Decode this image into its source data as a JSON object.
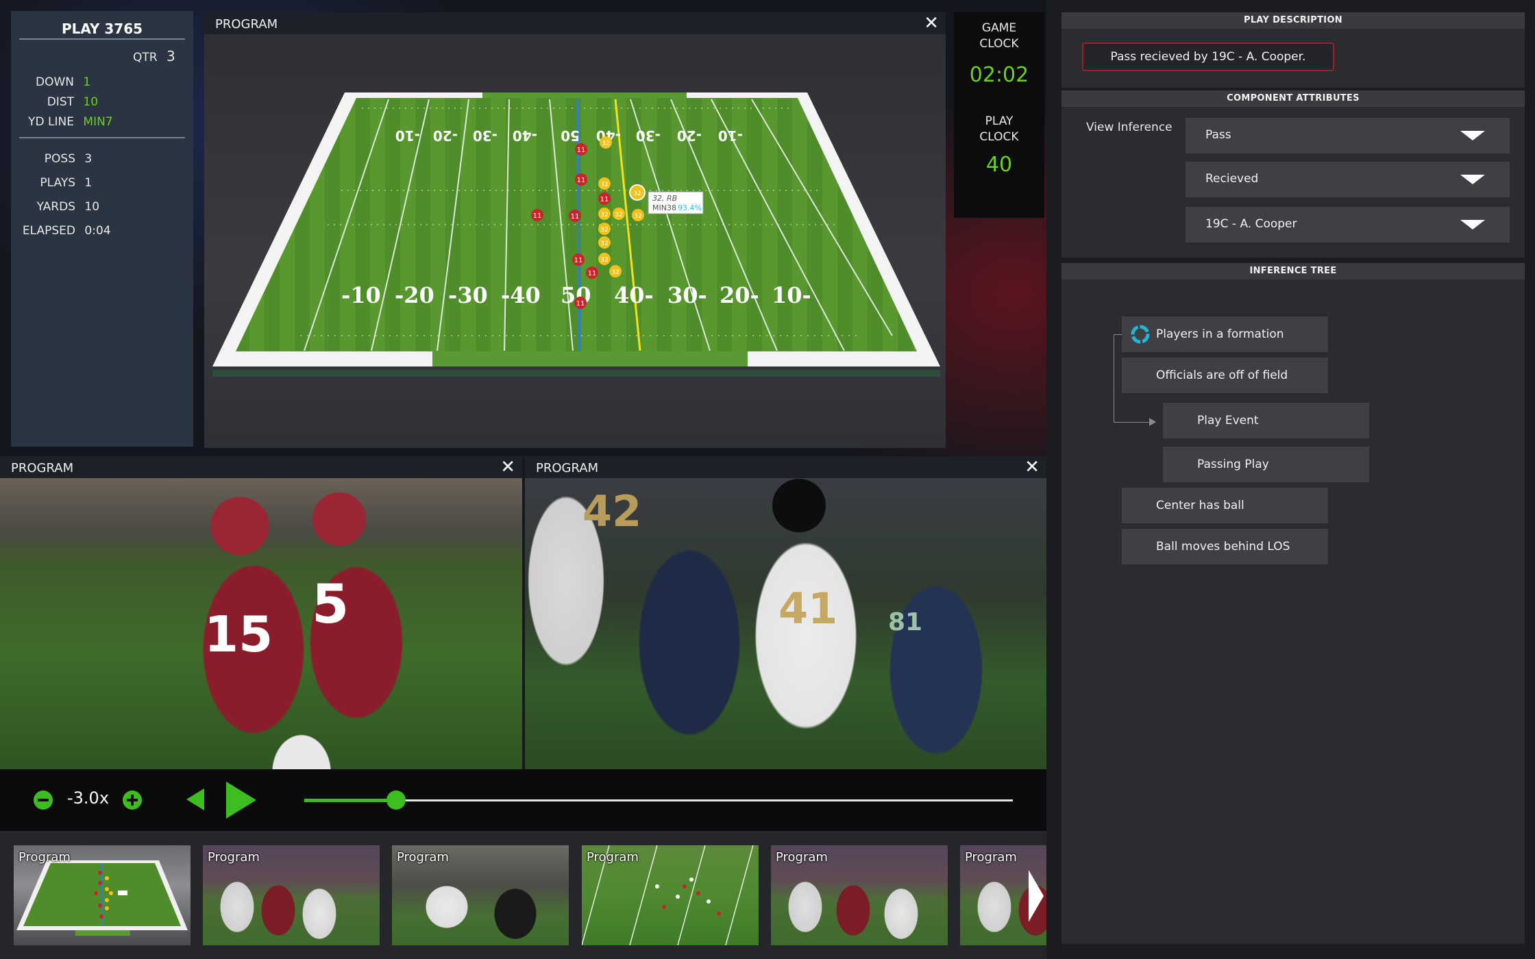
{
  "stats": {
    "play_title": "PLAY 3765",
    "qtr_label": "QTR",
    "qtr_value": "3",
    "down_label": "DOWN",
    "down_value": "1",
    "dist_label": "DIST",
    "dist_value": "10",
    "ydline_label": "YD LINE",
    "ydline_value": "MIN7",
    "poss_label": "POSS",
    "poss_value": "3",
    "plays_label": "PLAYS",
    "plays_value": "1",
    "yards_label": "YARDS",
    "yards_value": "10",
    "elapsed_label": "ELAPSED",
    "elapsed_value": "0:04"
  },
  "program_top": {
    "title": "PROGRAM",
    "close": "✕",
    "field_numbers_far": [
      "-10",
      "-20",
      "-30",
      "-40",
      "50",
      "-40",
      "-30",
      "-20",
      "-10"
    ],
    "field_numbers_near": [
      "-10",
      "-20",
      "-30",
      "-40",
      "50",
      "40-",
      "30-",
      "20-",
      "10-"
    ],
    "tooltip": {
      "line1": "32, RB",
      "line2_prefix": "MIN38",
      "line2_pct": "93.4%"
    },
    "players_red": [
      "11",
      "11",
      "11",
      "11",
      "11",
      "11",
      "11",
      "11"
    ],
    "players_yellow": [
      "32",
      "32",
      "32",
      "32",
      "32",
      "32",
      "32",
      "32",
      "32",
      "32"
    ]
  },
  "clocks": {
    "game_label_1": "GAME",
    "game_label_2": "CLOCK",
    "game_value": "02:02",
    "play_label_1": "PLAY",
    "play_label_2": "CLOCK",
    "play_value": "40"
  },
  "program_left": {
    "title": "PROGRAM",
    "close": "✕",
    "jersey_a": "15",
    "jersey_b": "5"
  },
  "program_right": {
    "title": "PROGRAM",
    "close": "✕",
    "jersey_a": "42",
    "jersey_b": "41",
    "jersey_c": "81"
  },
  "controls": {
    "speed": "-3.0x",
    "progress_fraction": 0.13,
    "accent": "#3dbd1f",
    "icons": [
      "minus-circle-icon",
      "plus-circle-icon",
      "rewind-icon",
      "play-icon"
    ]
  },
  "thumbnails": {
    "items": [
      {
        "label": "Program"
      },
      {
        "label": "Program"
      },
      {
        "label": "Program"
      },
      {
        "label": "Program"
      },
      {
        "label": "Program"
      },
      {
        "label": "Program"
      }
    ]
  },
  "play_description": {
    "header": "PLAY DESCRIPTION",
    "text": "Pass recieved by 19C - A. Cooper."
  },
  "component_attributes": {
    "header": "COMPONENT ATTRIBUTES",
    "view_inference_label": "View Inference",
    "dropdowns": [
      {
        "value": "Pass"
      },
      {
        "value": "Recieved"
      },
      {
        "value": "19C - A. Cooper"
      }
    ]
  },
  "inference_tree": {
    "header": "INFERENCE TREE",
    "nodes": [
      {
        "label": "Players in a formation"
      },
      {
        "label": "Officials are off of field"
      },
      {
        "label": "Play Event"
      },
      {
        "label": "Passing Play"
      },
      {
        "label": "Center has ball"
      },
      {
        "label": "Ball moves behind LOS"
      }
    ]
  },
  "colors": {
    "green": "#6bd11f",
    "alert_red": "#a41c28",
    "panel_gray": "#3f4044"
  }
}
